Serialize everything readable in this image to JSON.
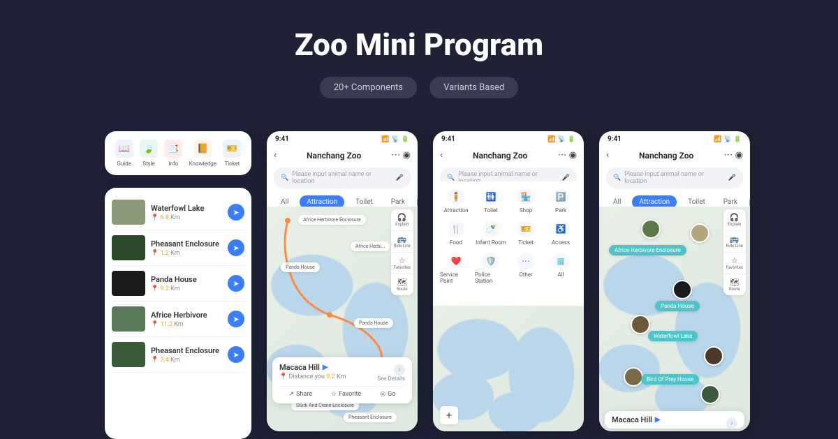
{
  "hero": {
    "title": "Zoo Mini Program"
  },
  "pills": {
    "p1": "20+ Components",
    "p2": "Variants Based"
  },
  "toolbar": {
    "items": [
      {
        "label": "Guide",
        "bg": "#eef2ff",
        "emoji": "📖"
      },
      {
        "label": "Style",
        "bg": "#e8f7ef",
        "emoji": "🍃"
      },
      {
        "label": "Info",
        "bg": "#ffeceb",
        "emoji": "📑"
      },
      {
        "label": "Knowledge",
        "bg": "#fff4e5",
        "emoji": "📙"
      },
      {
        "label": "Ticket",
        "bg": "#eaf3ff",
        "emoji": "🎫"
      }
    ]
  },
  "list": {
    "items": [
      {
        "title": "Waterfowl Lake",
        "dist": "6.8",
        "thumb": "#8a9a7a"
      },
      {
        "title": "Pheasant Enclosure",
        "dist": "1.2",
        "thumb": "#2a4a2a"
      },
      {
        "title": "Panda House",
        "dist": "9.2",
        "thumb": "#1a1a1a"
      },
      {
        "title": "Africe Herbivore",
        "dist": "11.2",
        "thumb": "#5a7a5a"
      },
      {
        "title": "Pheasant Enclosure",
        "dist": "3.4",
        "thumb": "#3a5a3a"
      }
    ],
    "unit": "Km"
  },
  "phone": {
    "time": "9:41",
    "title": "Nanchang Zoo",
    "search_placeholder": "Please input animal name or location",
    "tabs": {
      "all": "All",
      "attraction": "Attraction",
      "toilet": "Toilet",
      "park": "Park"
    },
    "sidetools": {
      "explain": "Explain",
      "rideline": "Ride Line",
      "favorites": "Favorites",
      "route": "Route"
    },
    "mapchips": {
      "c1": "Africe Herbivore Enclosure",
      "c2": "Africe Herbi...",
      "c3": "Panda House",
      "c4": "Panda House",
      "c5": "Stork And Crane Enclosure",
      "c6": "Pheasant Enclosure"
    },
    "maptags": {
      "t1": "Africe Herbivore Enclosure",
      "t2": "Panda House",
      "t3": "Waterfowl Lake",
      "t4": "Bird Of Prey House"
    },
    "bottomcard": {
      "title": "Macaca Hill",
      "dist_label": "Distance you",
      "dist": "9.2",
      "unit": "Km",
      "see": "See Details",
      "share": "Share",
      "favorite": "Favorite",
      "go": "Go"
    },
    "bottomcard2": {
      "title": "Macaca Hill"
    }
  },
  "categories": {
    "items": [
      {
        "label": "Attraction",
        "emoji": "🧍",
        "color": "#3b7dff"
      },
      {
        "label": "Toilet",
        "emoji": "🚻",
        "color": "#f5a623"
      },
      {
        "label": "Shop",
        "emoji": "🏪",
        "color": "#ff6b6b"
      },
      {
        "label": "Park",
        "emoji": "🅿️",
        "color": "#3b7dff"
      },
      {
        "label": "Food",
        "emoji": "🍴",
        "color": "#ff5c5c"
      },
      {
        "label": "Infant Room",
        "emoji": "🍼",
        "color": "#f5a623"
      },
      {
        "label": "Ticket",
        "emoji": "🎫",
        "color": "#4ec4c9"
      },
      {
        "label": "Access",
        "emoji": "♿",
        "color": "#3b7dff"
      },
      {
        "label": "Service Point",
        "emoji": "❤️",
        "color": "#ff4d6d"
      },
      {
        "label": "Police Station",
        "emoji": "🛡️",
        "color": "#3b7dff"
      },
      {
        "label": "Other",
        "emoji": "⋯",
        "color": "#3b7dff"
      },
      {
        "label": "All",
        "emoji": "▦",
        "color": "#4ec4c9"
      }
    ]
  }
}
